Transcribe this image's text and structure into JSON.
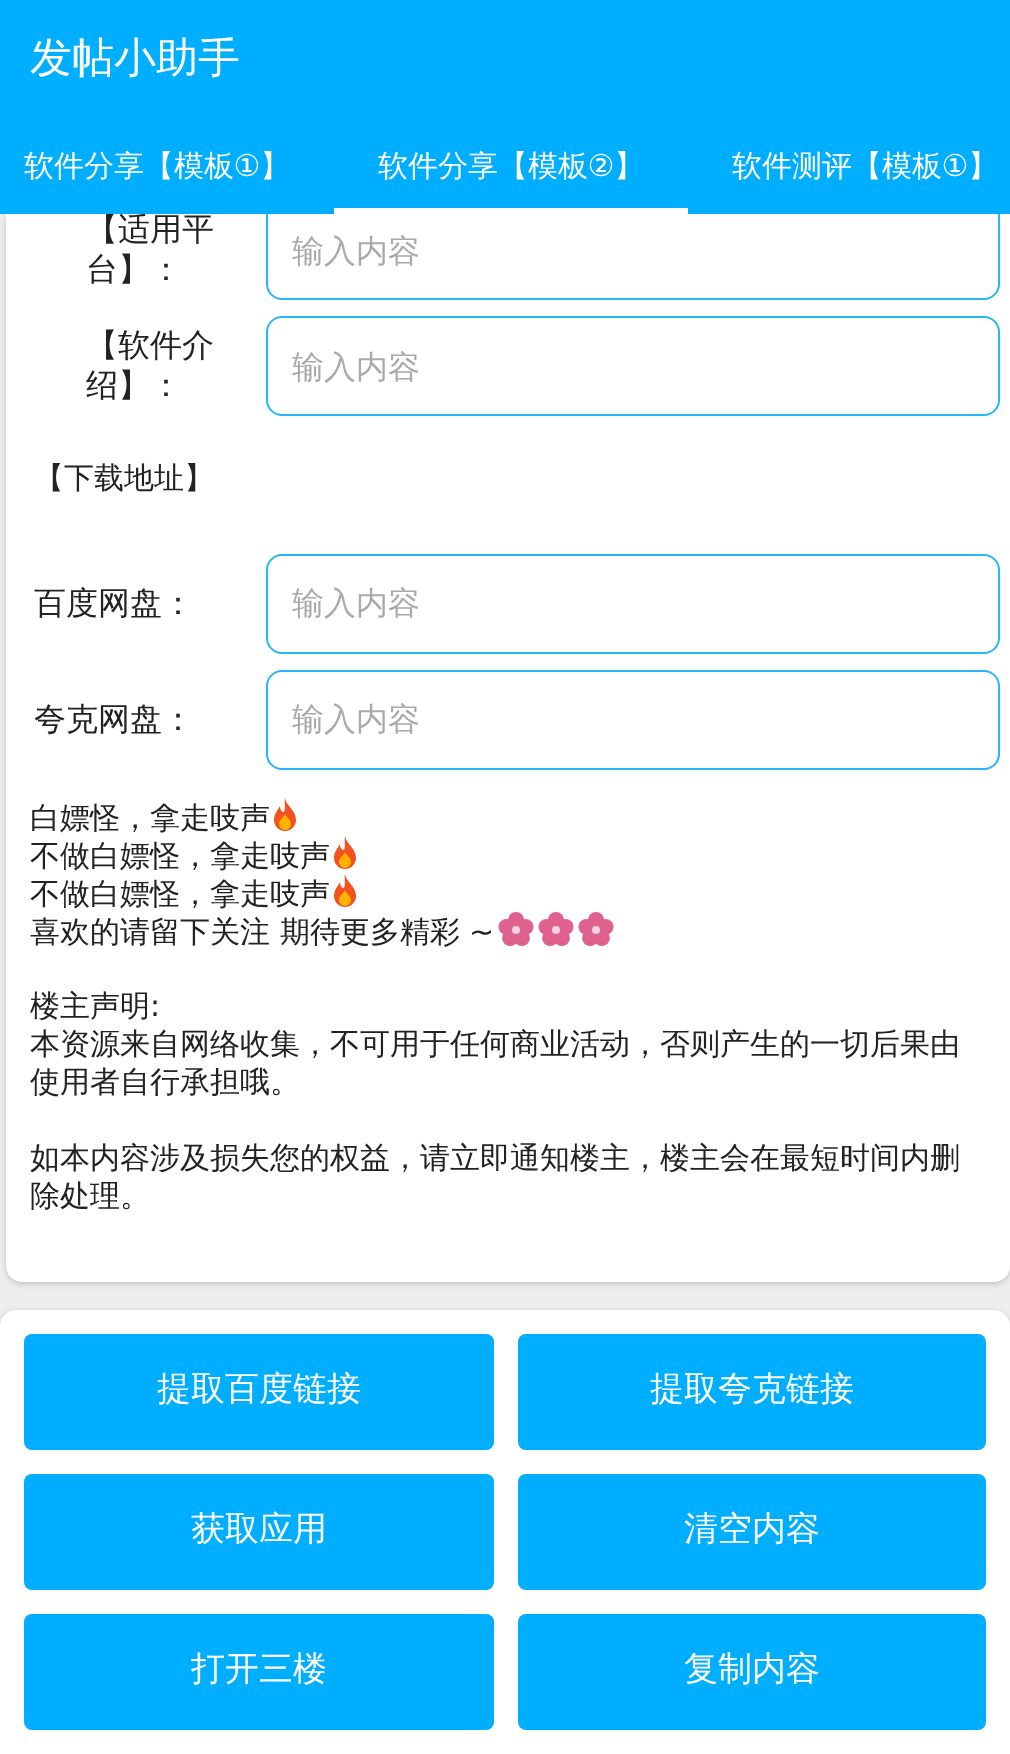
{
  "window": {
    "title": "发帖小助手"
  },
  "tabs": [
    {
      "label": "软件分享【模板①】",
      "selected": false
    },
    {
      "label": "软件分享【模板②】",
      "selected": true
    },
    {
      "label": "软件测评【模板①】",
      "selected": false
    }
  ],
  "form": [
    {
      "kind": "field",
      "label": "【适用平台】：",
      "placeholder": "输入内容"
    },
    {
      "kind": "field",
      "label": "【软件介绍】：",
      "placeholder": "输入内容"
    },
    {
      "kind": "heading",
      "label": "【下载地址】"
    },
    {
      "kind": "field",
      "label": "百度网盘：",
      "placeholder": "输入内容"
    },
    {
      "kind": "field",
      "label": "夸克网盘：",
      "placeholder": "输入内容"
    }
  ],
  "slogans": [
    {
      "text": "白嫖怪，拿走吱声",
      "kind": "fire"
    },
    {
      "text": "不做白嫖怪，拿走吱声",
      "kind": "fire"
    },
    {
      "text": "不做白嫖怪，拿走吱声",
      "kind": "fire"
    },
    {
      "text": "喜欢的请留下关注 期待更多精彩 ~",
      "kind": "flowers"
    }
  ],
  "statement": {
    "title": "楼主声明:",
    "paragraphs": [
      "本资源来自网络收集，不可用于任何商业活动，否则产生的一切后果由使用者自行承担哦。",
      "如本内容涉及损失您的权益，请立即通知楼主，楼主会在最短时间内删除处理。"
    ]
  },
  "buttons": [
    "提取百度链接",
    "提取夸克链接",
    "获取应用",
    "清空内容",
    "打开三楼",
    "复制内容"
  ]
}
